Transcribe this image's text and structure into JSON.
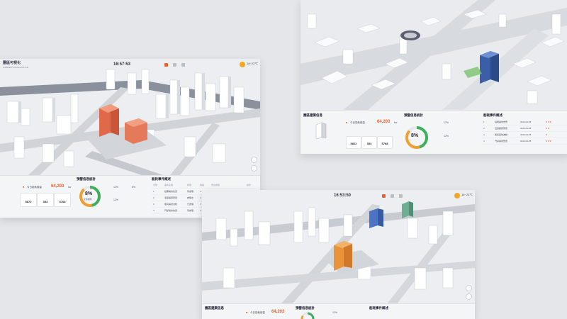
{
  "colors": {
    "accent": "#e8622c",
    "donut_green": "#3fae5b",
    "donut_orange": "#f0a030",
    "bg": "#e4e6e9"
  },
  "panel_left": {
    "title": "園區可視化",
    "subtitle": "GARDEN VISUALIZATION",
    "clock": "16:57:53",
    "weather": "18~23℃",
    "bottom": {
      "stats_title": "今日能耗總量",
      "stats_value": "64,203",
      "stats_unit": "kw",
      "stat_values": [
        "5872",
        "353",
        "5768"
      ],
      "alarm_title": "預警信息統計",
      "donut_pct": "8%",
      "donut_label": "全部處理",
      "pct_top": "12%",
      "pct_bottom": "12%",
      "pct_right": "8%",
      "table_title": "能耗事件概述",
      "table_headers": [
        "序號",
        "事件名稱",
        "狀態",
        "等級",
        "發生時間",
        "操作"
      ],
      "table_rows": [
        [
          "1",
          "設備異常告警",
          "待處理",
          "★★★",
          "2022-04-05 11:20",
          "查看"
        ],
        [
          "2",
          "溫度超標預警",
          "處理中",
          "★★",
          "2022-04-05 11:18",
          "查看"
        ],
        [
          "3",
          "能耗異常波動",
          "已處理",
          "★",
          "2022-04-05 11:09",
          "查看"
        ],
        [
          "4",
          "門禁異常告警",
          "待處理",
          "★★★",
          "2022-04-05 10:59",
          "查看"
        ]
      ]
    }
  },
  "panel_right": {
    "bottom": {
      "building_title": "園區建築信息",
      "stats_title": "今日能耗總量",
      "stats_value": "64,203",
      "stats_unit": "kw",
      "stat_values": [
        "5822",
        "353",
        "5768"
      ],
      "alarm_title": "預警信息統計",
      "donut_pct": "8%",
      "donut_label": "全部處理",
      "pct_top": "12%",
      "pct_bottom": "12%",
      "table_title": "能耗事件概述",
      "table_rows": [
        [
          "1",
          "設備異常告警",
          "2022-04-05",
          "★★★"
        ],
        [
          "2",
          "溫度超標預警",
          "2022-04-05",
          "★★"
        ],
        [
          "3",
          "能耗異常波動",
          "2022-04-05",
          "★"
        ],
        [
          "4",
          "門禁異常告警",
          "2022-04-05",
          "★★★"
        ]
      ]
    }
  },
  "panel_bottom": {
    "clock": "16:53:50",
    "weather": "18~23℃",
    "bottom": {
      "building_title": "園區建築信息",
      "stats_title": "今日能耗總量",
      "stats_value": "64,203",
      "alarm_title": "預警信息統計",
      "pct_top": "12%",
      "table_title": "能耗事件概述"
    }
  }
}
